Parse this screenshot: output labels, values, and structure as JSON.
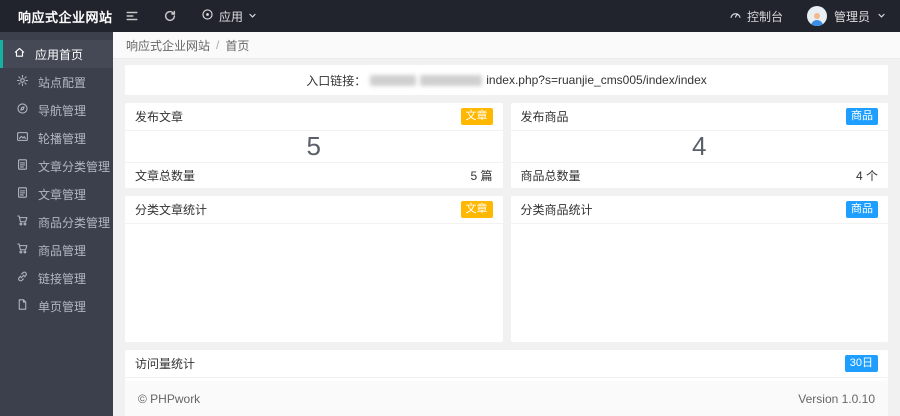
{
  "colors": {
    "header_bg": "#21242d",
    "sidebar_bg": "#3b404c",
    "accent_teal": "#14b2a0",
    "badge_yellow": "#FFB800",
    "badge_blue": "#1E9FFF"
  },
  "header": {
    "app_title": "响应式企业网站",
    "app_menu_label": "应用",
    "console_label": "控制台",
    "user_name": "管理员"
  },
  "sidebar": {
    "items": [
      {
        "label": "应用首页",
        "icon": "home-icon",
        "active": true
      },
      {
        "label": "站点配置",
        "icon": "gear-icon"
      },
      {
        "label": "导航管理",
        "icon": "compass-icon"
      },
      {
        "label": "轮播管理",
        "icon": "carousel-image-icon"
      },
      {
        "label": "文章分类管理",
        "icon": "document-icon"
      },
      {
        "label": "文章管理",
        "icon": "document-icon"
      },
      {
        "label": "商品分类管理",
        "icon": "cart-icon"
      },
      {
        "label": "商品管理",
        "icon": "cart-icon"
      },
      {
        "label": "链接管理",
        "icon": "link-icon"
      },
      {
        "label": "单页管理",
        "icon": "page-icon"
      }
    ]
  },
  "breadcrumb": {
    "root": "响应式企业网站",
    "separator": "/",
    "current": "首页"
  },
  "entry": {
    "label": "入口链接：",
    "url_suffix": "index.php?s=ruanjie_cms005/index/index"
  },
  "stat_cards": [
    {
      "title": "发布文章",
      "badge": "文章",
      "badge_color": "#FFB800",
      "value": "5",
      "footer_label": "文章总数量",
      "footer_value": "5 篇"
    },
    {
      "title": "发布商品",
      "badge": "商品",
      "badge_color": "#1E9FFF",
      "value": "4",
      "footer_label": "商品总数量",
      "footer_value": "4 个"
    }
  ],
  "chart_cards": [
    {
      "title": "分类文章统计",
      "badge": "文章",
      "badge_color": "#FFB800"
    },
    {
      "title": "分类商品统计",
      "badge": "商品",
      "badge_color": "#1E9FFF"
    }
  ],
  "visits_card": {
    "title": "访问量统计",
    "badge": "30日",
    "badge_color": "#1E9FFF"
  },
  "footer": {
    "copyright": "© PHPwork",
    "version": "Version 1.0.10"
  }
}
